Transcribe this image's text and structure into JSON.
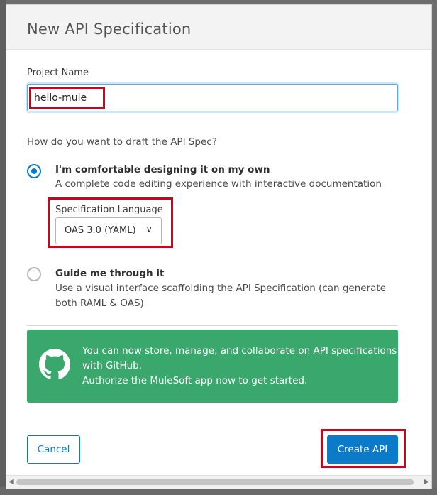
{
  "dialog": {
    "title": "New API Specification"
  },
  "project": {
    "label": "Project Name",
    "value": "hello-mule"
  },
  "draft": {
    "question": "How do you want to draft the API Spec?",
    "options": [
      {
        "title": "I'm comfortable designing it on my own",
        "description": "A complete code editing experience with interactive documentation",
        "selected": true
      },
      {
        "title": "Guide me through it",
        "description_line1": "Use a visual interface scaffolding the API Specification (can generate",
        "description_line2": "both RAML & OAS)",
        "selected": false
      }
    ]
  },
  "spec_language": {
    "label": "Specification Language",
    "selected": "OAS 3.0 (YAML)",
    "chevron": "∨"
  },
  "github_banner": {
    "icon": "github-icon",
    "line1": "You can now store, manage, and collaborate on API specifications",
    "line2": "with GitHub.",
    "line3": "Authorize the MuleSoft app now to get started."
  },
  "buttons": {
    "cancel": "Cancel",
    "create": "Create API"
  },
  "colors": {
    "accent": "#0a7ac9",
    "banner": "#3aa76d",
    "highlight": "#d0021b"
  }
}
